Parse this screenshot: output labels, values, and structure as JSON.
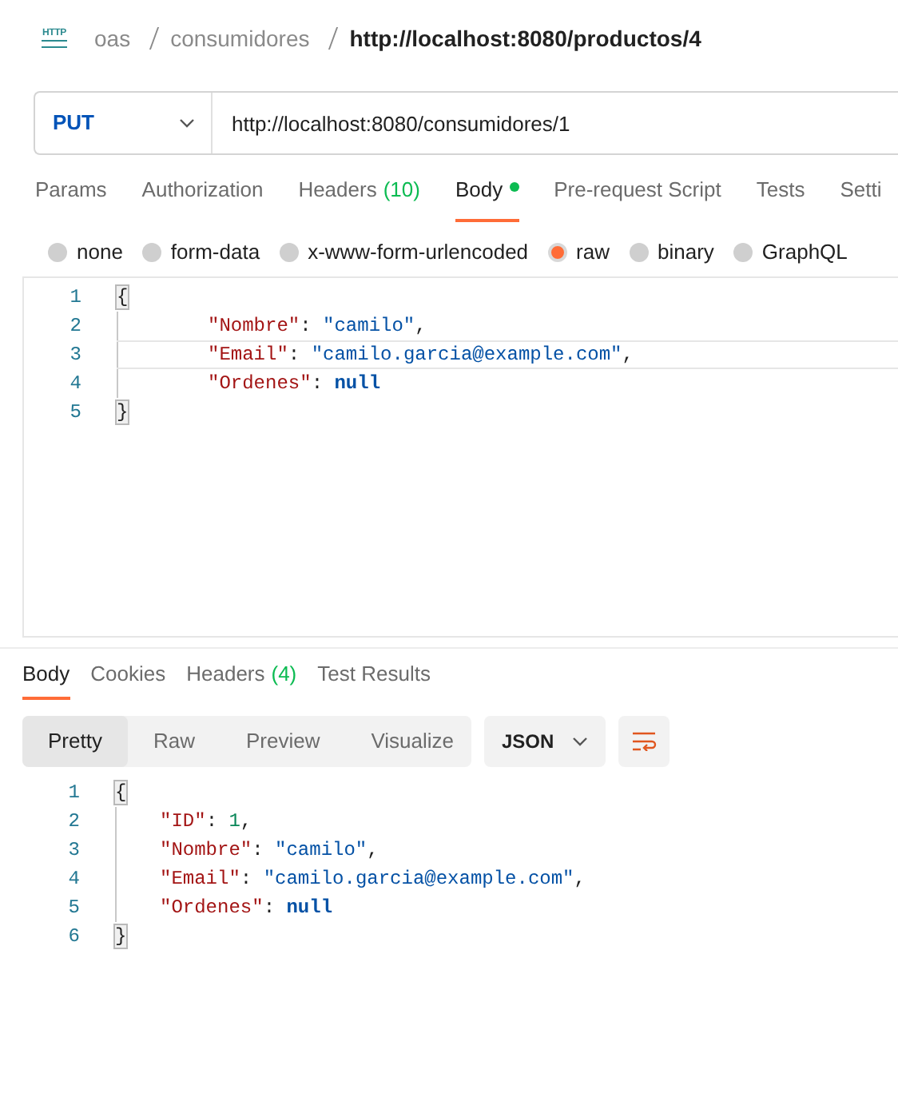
{
  "breadcrumb": {
    "icon_text": "HTTP",
    "path": [
      "oas",
      "consumidores"
    ],
    "title": "http://localhost:8080/productos/4"
  },
  "request": {
    "method": "PUT",
    "url": "http://localhost:8080/consumidores/1"
  },
  "request_tabs": [
    {
      "label": "Params",
      "selected": false,
      "has_content": false
    },
    {
      "label": "Authorization",
      "selected": false,
      "has_content": false
    },
    {
      "label": "Headers",
      "count": "(10)",
      "selected": false,
      "has_content": false
    },
    {
      "label": "Body",
      "selected": true,
      "has_content": true
    },
    {
      "label": "Pre-request Script",
      "selected": false,
      "has_content": false
    },
    {
      "label": "Tests",
      "selected": false,
      "has_content": false
    },
    {
      "label": "Setti",
      "selected": false,
      "has_content": false
    }
  ],
  "body_types": [
    {
      "label": "none",
      "selected": false
    },
    {
      "label": "form-data",
      "selected": false
    },
    {
      "label": "x-www-form-urlencoded",
      "selected": false
    },
    {
      "label": "raw",
      "selected": true
    },
    {
      "label": "binary",
      "selected": false
    },
    {
      "label": "GraphQL",
      "selected": false
    }
  ],
  "request_body": {
    "lines": [
      {
        "number": "1",
        "active": false,
        "tokens": [
          {
            "kind": "brace",
            "text": "{"
          }
        ],
        "children": [
          {
            "number": "2",
            "active": false,
            "tokens": [
              {
                "kind": "key",
                "text": "\"Nombre\""
              },
              {
                "kind": "punct",
                "text": ": "
              },
              {
                "kind": "string",
                "text": "\"camilo\""
              },
              {
                "kind": "punct",
                "text": ","
              }
            ]
          },
          {
            "number": "3",
            "active": true,
            "tokens": [
              {
                "kind": "key",
                "text": "\"Email\""
              },
              {
                "kind": "punct",
                "text": ": "
              },
              {
                "kind": "string",
                "text": "\"camilo.garcia@example.com\""
              },
              {
                "kind": "punct",
                "text": ","
              }
            ]
          },
          {
            "number": "4",
            "active": false,
            "tokens": [
              {
                "kind": "key",
                "text": "\"Ordenes\""
              },
              {
                "kind": "punct",
                "text": ": "
              },
              {
                "kind": "null",
                "text": "null"
              }
            ]
          }
        ]
      },
      {
        "number": "5",
        "active": false,
        "tokens": [
          {
            "kind": "brace",
            "text": "}"
          }
        ]
      }
    ]
  },
  "response_tabs": [
    {
      "label": "Body",
      "selected": true
    },
    {
      "label": "Cookies",
      "selected": false
    },
    {
      "label": "Headers",
      "count": "(4)",
      "selected": false
    },
    {
      "label": "Test Results",
      "selected": false
    }
  ],
  "view_modes": [
    {
      "label": "Pretty",
      "selected": true
    },
    {
      "label": "Raw",
      "selected": false
    },
    {
      "label": "Preview",
      "selected": false
    },
    {
      "label": "Visualize",
      "selected": false
    }
  ],
  "format": "JSON",
  "response_body": {
    "lines": [
      {
        "number": "1",
        "tokens": [
          {
            "kind": "brace",
            "text": "{"
          }
        ],
        "children": [
          {
            "number": "2",
            "tokens": [
              {
                "kind": "key",
                "text": "\"ID\""
              },
              {
                "kind": "punct",
                "text": ": "
              },
              {
                "kind": "number",
                "text": "1"
              },
              {
                "kind": "punct",
                "text": ","
              }
            ]
          },
          {
            "number": "3",
            "tokens": [
              {
                "kind": "key",
                "text": "\"Nombre\""
              },
              {
                "kind": "punct",
                "text": ": "
              },
              {
                "kind": "string",
                "text": "\"camilo\""
              },
              {
                "kind": "punct",
                "text": ","
              }
            ]
          },
          {
            "number": "4",
            "tokens": [
              {
                "kind": "key",
                "text": "\"Email\""
              },
              {
                "kind": "punct",
                "text": ": "
              },
              {
                "kind": "string",
                "text": "\"camilo.garcia@example.com\""
              },
              {
                "kind": "punct",
                "text": ","
              }
            ]
          },
          {
            "number": "5",
            "tokens": [
              {
                "kind": "key",
                "text": "\"Ordenes\""
              },
              {
                "kind": "punct",
                "text": ": "
              },
              {
                "kind": "null",
                "text": "null"
              }
            ]
          }
        ]
      },
      {
        "number": "6",
        "tokens": [
          {
            "kind": "brace",
            "text": "}"
          }
        ]
      }
    ]
  }
}
